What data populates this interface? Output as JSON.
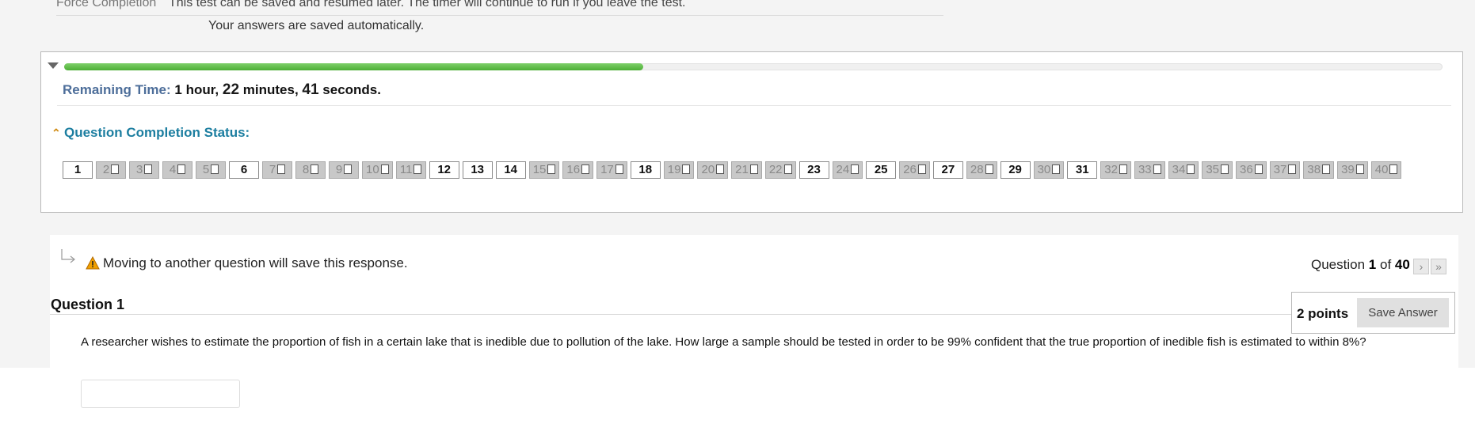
{
  "info": {
    "force_label": "Force Completion",
    "force_text": "This test can be saved and resumed later. The timer will continue to run if you leave the test.",
    "autosave_text": "Your answers are saved automatically."
  },
  "timer": {
    "progress_fraction": 0.42,
    "label": "Remaining Time:",
    "hours": "1",
    "hour_word": "hour,",
    "minutes": "22",
    "minute_word": "minutes,",
    "seconds": "41",
    "second_word": "seconds."
  },
  "completion": {
    "title": "Question Completion Status:",
    "answered": [
      1,
      6,
      12,
      13,
      14,
      18,
      23,
      25,
      27,
      29,
      31
    ],
    "total": 40
  },
  "question_nav": {
    "warning": "Moving to another question will save this response.",
    "position_prefix": "Question",
    "current": "1",
    "of_word": "of",
    "total": "40",
    "next_symbol": "›",
    "last_symbol": "»"
  },
  "question": {
    "header": "Question 1",
    "points": "2 points",
    "save_label": "Save Answer",
    "text": "A researcher wishes to estimate the proportion of fish in a certain lake that is inedible due to pollution of the lake. How large a sample should be tested in order to be 99% confident that the true proportion of inedible fish is estimated to within 8%?",
    "answer_value": ""
  },
  "colors": {
    "progress": "#5cbf45",
    "timer_label": "#4d6e9a",
    "status_title": "#1c7ea0",
    "warning": "#f0a000"
  }
}
